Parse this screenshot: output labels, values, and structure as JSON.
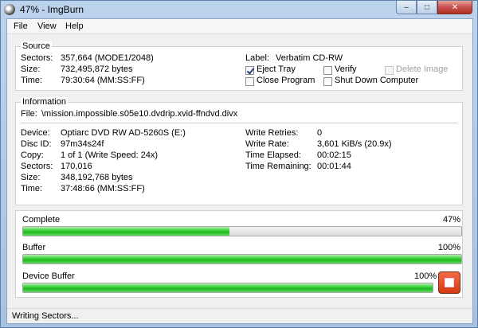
{
  "window": {
    "title": "47% - ImgBurn",
    "minimize": "–",
    "maximize": "□",
    "close": "✕"
  },
  "menu": [
    "File",
    "View",
    "Help"
  ],
  "source": {
    "label": "Source",
    "sectors_label": "Sectors:",
    "sectors_value": "357,664 (MODE1/2048)",
    "size_label": "Size:",
    "size_value": "732,495,872 bytes",
    "time_label": "Time:",
    "time_value": "79:30:64 (MM:SS:FF)",
    "disc_label_label": "Label:",
    "disc_label_value": "Verbatim CD-RW",
    "options": [
      {
        "label": "Eject Tray",
        "checked": true,
        "enabled": true
      },
      {
        "label": "Verify",
        "checked": false,
        "enabled": true
      },
      {
        "label": "Delete Image",
        "checked": false,
        "enabled": false
      },
      {
        "label": "Close Program",
        "checked": false,
        "enabled": true
      },
      {
        "label": "Shut Down Computer",
        "checked": false,
        "enabled": true
      }
    ]
  },
  "information": {
    "label": "Information",
    "file_label": "File:",
    "file_value": "\\mission.impossible.s05e10.dvdrip.xvid-ffndvd.divx",
    "device_label": "Device:",
    "device_value": "Optiarc DVD RW AD-5260S (E:)",
    "discid_label": "Disc ID:",
    "discid_value": "97m34s24f",
    "copy_label": "Copy:",
    "copy_value": "1 of 1 (Write Speed: 24x)",
    "sectors_label": "Sectors:",
    "sectors_value": "170,016",
    "size_label": "Size:",
    "size_value": "348,192,768 bytes",
    "time_label": "Time:",
    "time_value": "37:48:66 (MM:SS:FF)",
    "retries_label": "Write Retries:",
    "retries_value": "0",
    "rate_label": "Write Rate:",
    "rate_value": "3,601 KiB/s (20.9x)",
    "elapsed_label": "Time Elapsed:",
    "elapsed_value": "00:02:15",
    "remaining_label": "Time Remaining:",
    "remaining_value": "00:01:44"
  },
  "progress": {
    "complete_label": "Complete",
    "complete_pct": "47%",
    "complete_fraction": 0.47,
    "buffer_label": "Buffer",
    "buffer_pct": "100%",
    "buffer_fraction": 1.0,
    "device_buffer_label": "Device Buffer",
    "device_buffer_pct": "100%",
    "device_buffer_fraction": 1.0
  },
  "status": {
    "text": "Writing Sectors..."
  },
  "colors": {
    "progress_green": "#1fb81f",
    "stop_button": "#d43b14"
  }
}
